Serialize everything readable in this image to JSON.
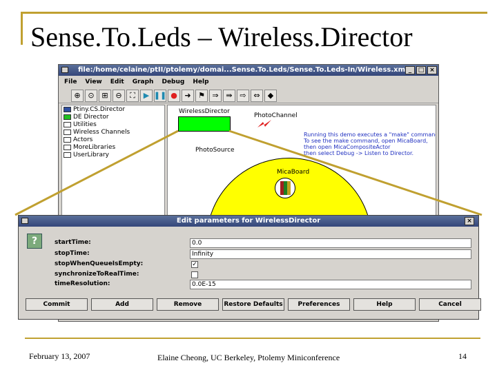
{
  "slide": {
    "title": "Sense.To.Leds – Wireless.Director",
    "footer_date": "February 13, 2007",
    "footer_author": "Elaine Cheong, UC Berkeley, Ptolemy Miniconference",
    "footer_page": "14",
    "accent_color": "#c0a030"
  },
  "window": {
    "title": "file:/home/celaine/ptII/ptolemy/domai...Sense.To.Leds/Sense.To.Leds-In/Wireless.xml",
    "btn_min": "_",
    "btn_max": "□",
    "btn_close": "×",
    "menu": [
      "File",
      "View",
      "Edit",
      "Graph",
      "Debug",
      "Help"
    ],
    "toolbar_icons": [
      {
        "name": "zoom-in-icon",
        "glyph": "⊕"
      },
      {
        "name": "zoom-reset-icon",
        "glyph": "⊙"
      },
      {
        "name": "zoom-fit-icon",
        "glyph": "⊞"
      },
      {
        "name": "zoom-out-icon",
        "glyph": "⊖"
      },
      {
        "name": "full-screen-icon",
        "glyph": "⛶"
      },
      {
        "name": "run-icon",
        "glyph": "▶"
      },
      {
        "name": "pause-icon",
        "glyph": "❚❚"
      },
      {
        "name": "stop-icon",
        "glyph": "●"
      },
      {
        "name": "arrow-icon",
        "glyph": "➜"
      },
      {
        "name": "flag-icon",
        "glyph": "⚑"
      },
      {
        "name": "port-icon",
        "glyph": "⇒"
      },
      {
        "name": "multiport-icon",
        "glyph": "⇛"
      },
      {
        "name": "output-port-icon",
        "glyph": "⇨"
      },
      {
        "name": "inout-port-icon",
        "glyph": "⇔"
      },
      {
        "name": "relation-icon",
        "glyph": "◆"
      }
    ],
    "tree": [
      {
        "label": "Ptiny.CS.Director",
        "icon": "blue"
      },
      {
        "label": "DE Director",
        "icon": "green"
      },
      {
        "label": "Utilities",
        "icon": "plain"
      },
      {
        "label": "Wireless Channels",
        "icon": "plain"
      },
      {
        "label": "Actors",
        "icon": "plain"
      },
      {
        "label": "MoreLibraries",
        "icon": "plain"
      },
      {
        "label": "UserLibrary",
        "icon": "plain"
      }
    ],
    "canvas": {
      "director_label": "WirelessDirector",
      "channel_label": "PhotoChannel",
      "source_label": "PhotoSource",
      "board_label": "MicaBoard",
      "note": "Running this demo executes a \"make\" command.\nTo see the make command, open MicaBoard,\nthen open MicaCompositeActor\nthen select Debug -> Listen to Director.",
      "director_color": "#00ff00",
      "source_color": "#ffff00",
      "note_color": "#2030c0"
    }
  },
  "dialog": {
    "title": "Edit parameters for WirelessDirector",
    "btn_close": "×",
    "help_glyph": "?",
    "params": [
      {
        "label": "startTime:",
        "value": "0.0",
        "kind": "text"
      },
      {
        "label": "stopTime:",
        "value": "Infinity",
        "kind": "text"
      },
      {
        "label": "stopWhenQueueIsEmpty:",
        "value": "✓",
        "kind": "check"
      },
      {
        "label": "synchronizeToRealTime:",
        "value": "",
        "kind": "check"
      },
      {
        "label": "timeResolution:",
        "value": "0.0E-15",
        "kind": "text"
      }
    ],
    "buttons": [
      "Commit",
      "Add",
      "Remove",
      "Restore Defaults",
      "Preferences",
      "Help",
      "Cancel"
    ]
  }
}
